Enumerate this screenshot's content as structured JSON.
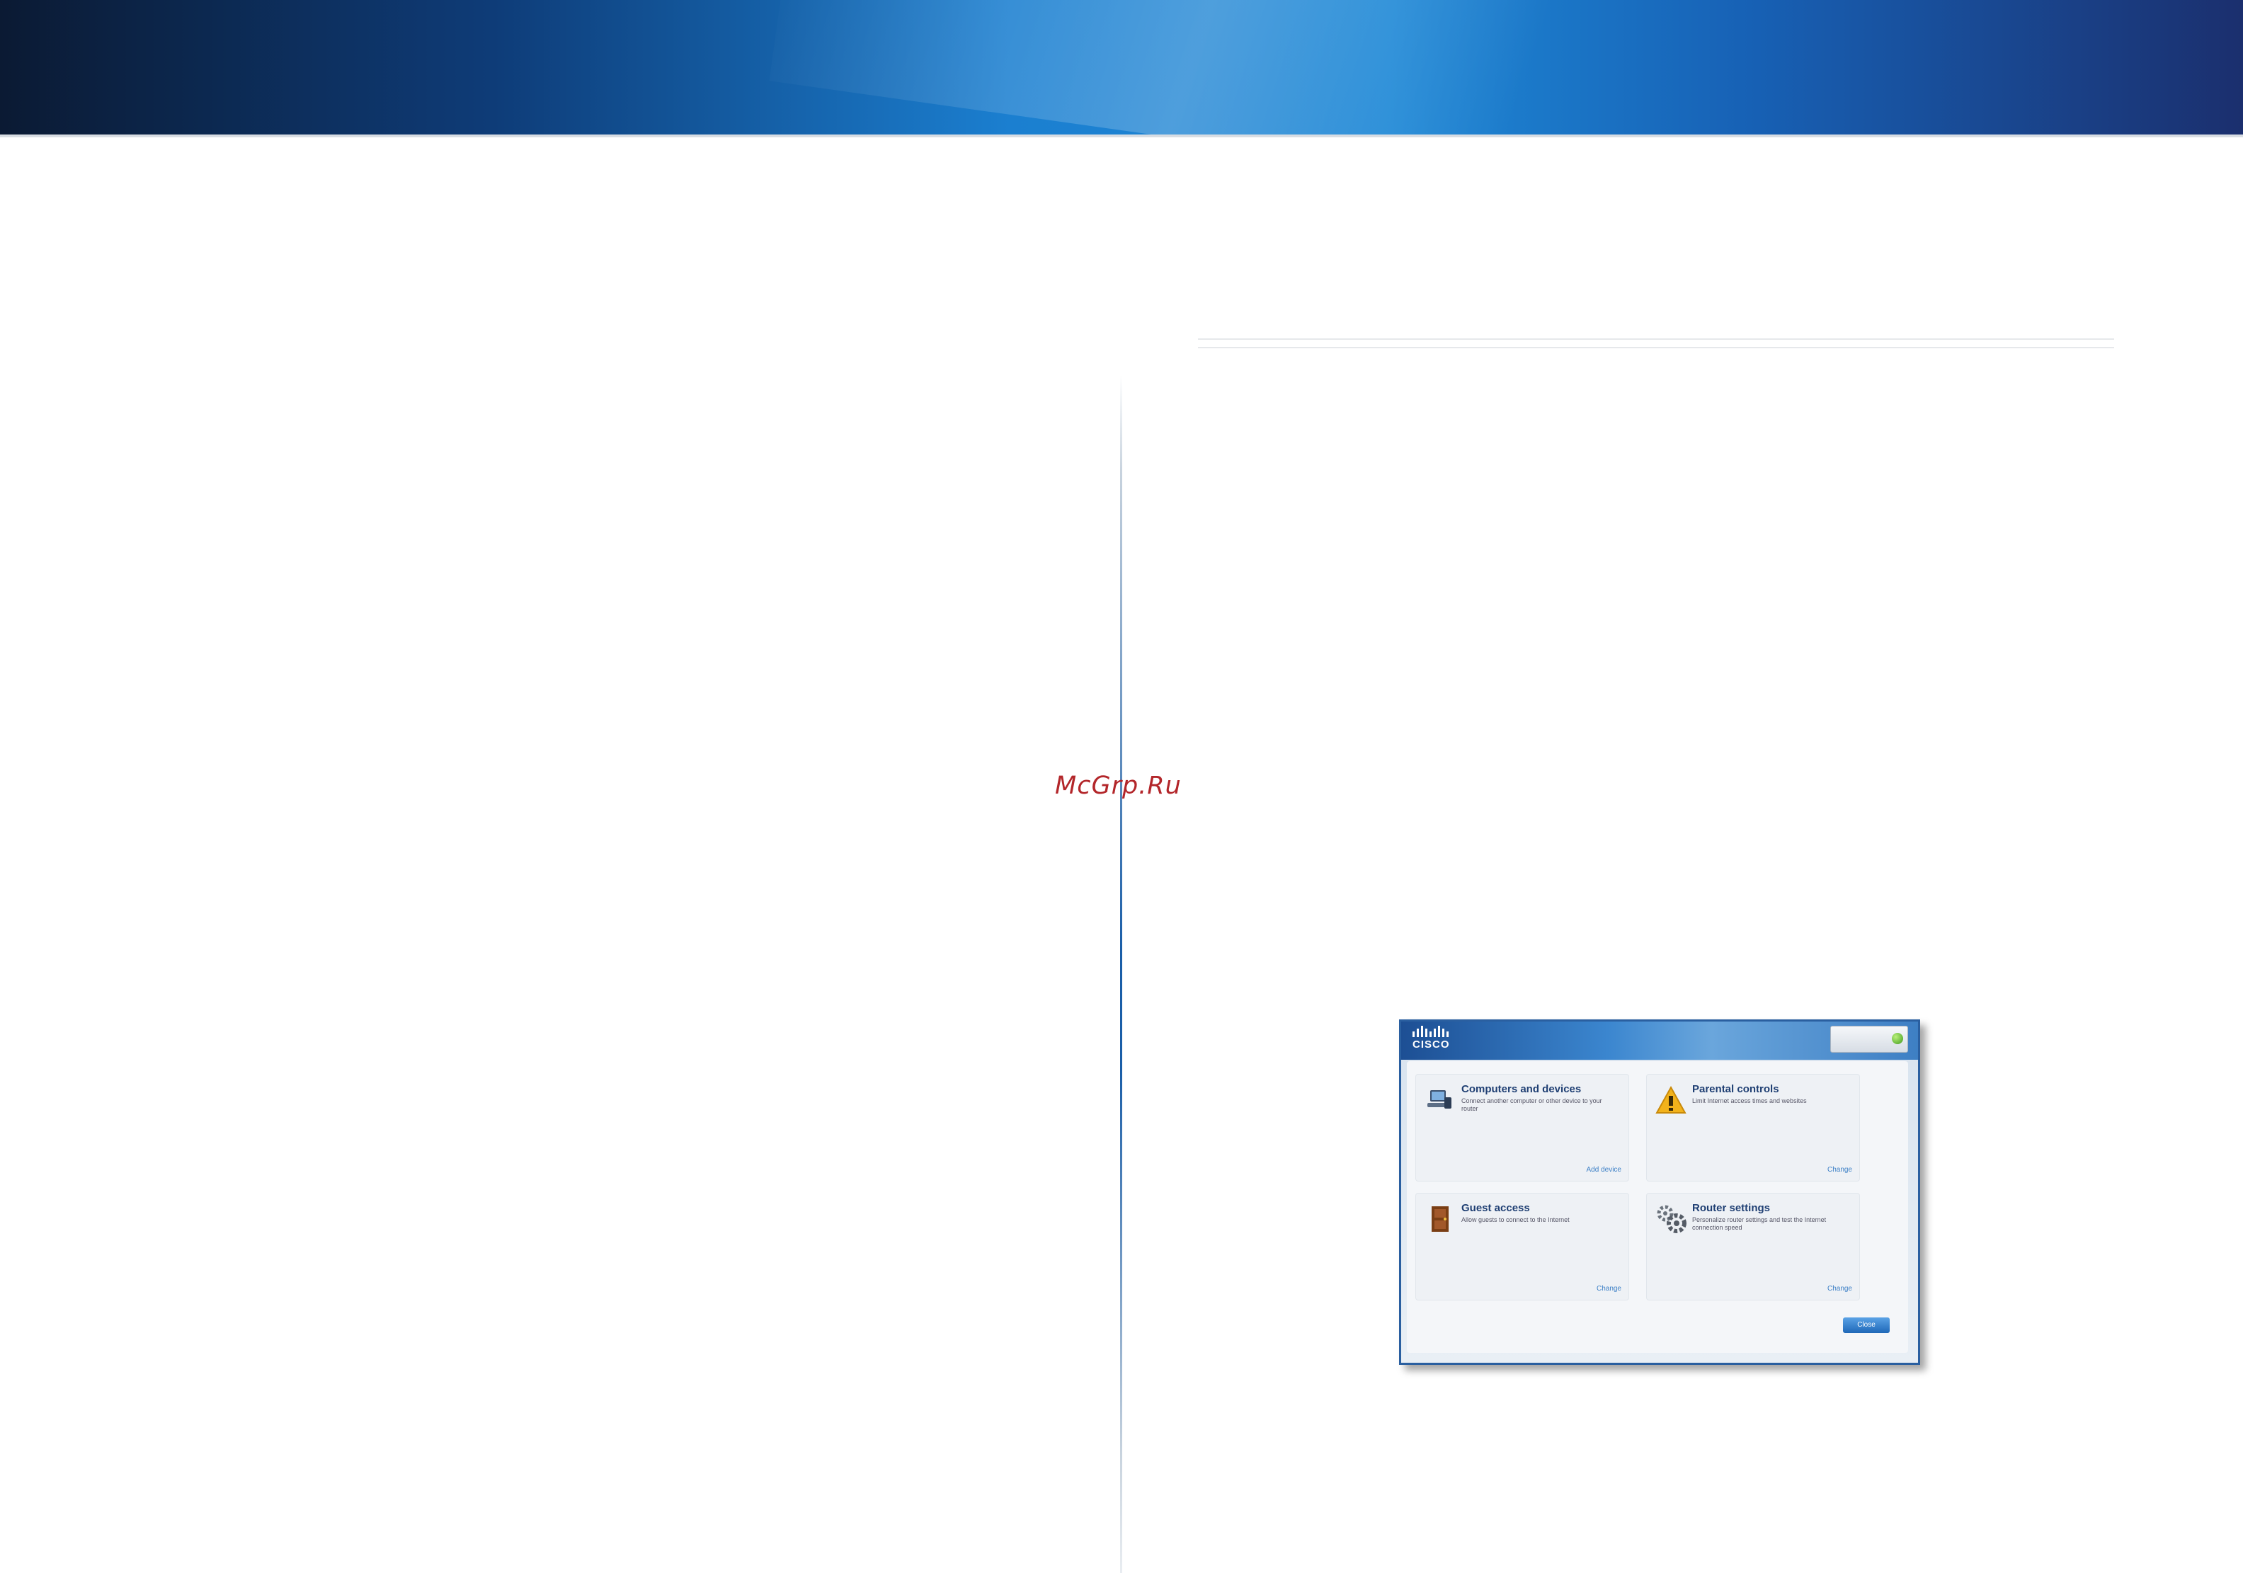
{
  "watermark": "McGrp.Ru",
  "router_ui": {
    "status_text": "",
    "cards": [
      {
        "title": "Computers and devices",
        "description": "Connect another computer or other device to your router",
        "status": "",
        "link": "Add device",
        "icon": "computer-icon"
      },
      {
        "title": "Parental controls",
        "description": "Limit Internet access times and websites",
        "status": "",
        "link": "Change",
        "icon": "warning-icon"
      },
      {
        "title": "Guest access",
        "description": "Allow guests to connect to the Internet",
        "status": "",
        "link": "Change",
        "icon": "door-icon"
      },
      {
        "title": "Router settings",
        "description": "Personalize router settings and test the Internet connection speed",
        "status": "",
        "link": "Change",
        "icon": "gears-icon"
      }
    ],
    "close_label": "Close",
    "colors": {
      "header": "#1d4f94",
      "link": "#3b7fc6",
      "title": "#1f3f73"
    }
  }
}
